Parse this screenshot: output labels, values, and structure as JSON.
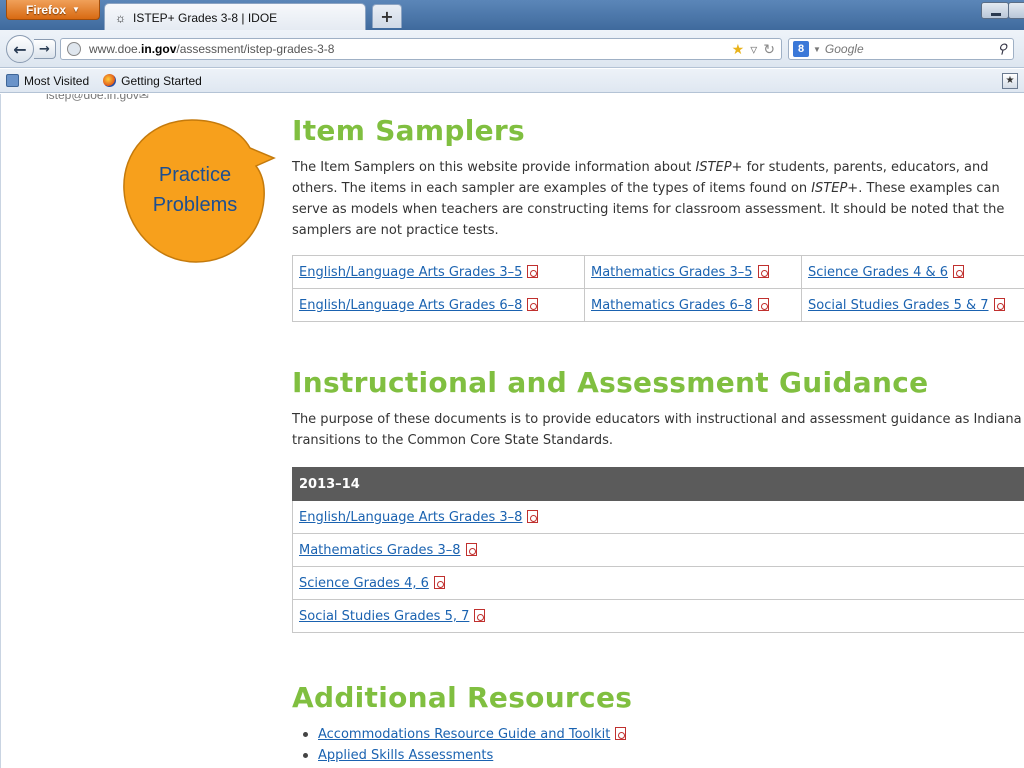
{
  "browser": {
    "menu_button": "Firefox",
    "tab_title": "ISTEP+ Grades 3-8 | IDOE",
    "new_tab": "+",
    "url_prefix": "www.doe.",
    "url_domain": "in.gov",
    "url_path": "/assessment/istep-grades-3-8",
    "search_engine": "Google",
    "bookmarks": [
      "Most Visited",
      "Getting Started"
    ]
  },
  "page": {
    "email_fragment": "istep@doe.in.gov",
    "callout": {
      "line1": "Practice",
      "line2": "Problems",
      "fill": "#f7a01c"
    },
    "item_samplers": {
      "title": "Item Samplers",
      "intro_1": "The Item Samplers on this website provide information about ",
      "intro_em1": "ISTEP+",
      "intro_2": " for students, parents, educators, and others. The items in each sampler are examples of the types of items found on ",
      "intro_em2": "ISTEP+",
      "intro_3": ". These examples can serve as models when teachers are constructing items for classroom assessment. It should be noted that the samplers are not practice tests.",
      "rows": [
        [
          "English/Language Arts Grades 3–5",
          "Mathematics Grades 3–5",
          "Science Grades 4 & 6"
        ],
        [
          "English/Language Arts Grades 6–8",
          "Mathematics Grades 6–8",
          "Social Studies Grades 5 & 7"
        ]
      ]
    },
    "guidance": {
      "title": "Instructional and Assessment Guidance",
      "intro": "The purpose of these documents is to provide educators with instructional and assessment guidance as Indiana transitions to the Common Core State Standards.",
      "header": "2013–14",
      "links": [
        "English/Language Arts Grades 3–8",
        "Mathematics Grades 3–8",
        "Science Grades 4, 6",
        "Social Studies Grades 5, 7"
      ]
    },
    "resources": {
      "title": "Additional Resources",
      "items": [
        "Accommodations Resource Guide and Toolkit",
        "Applied Skills Assessments"
      ]
    }
  },
  "colors": {
    "heading_green": "#80bf40",
    "link_blue": "#1a62b0",
    "table_header": "#5b5b5b",
    "callout_orange": "#f7a01c"
  }
}
